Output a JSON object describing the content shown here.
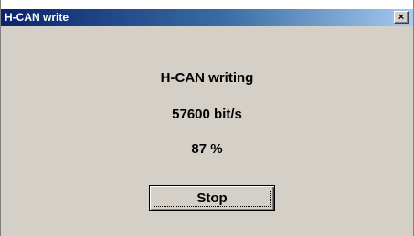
{
  "window": {
    "title": "H-CAN write",
    "close_glyph": "×",
    "titlebar_color_start": "#0a246a",
    "titlebar_color_end": "#a6caf0",
    "background_color": "#d4d0c8"
  },
  "status": {
    "heading": "H-CAN writing",
    "bitrate": "57600 bit/s",
    "progress": "87 %",
    "progress_value": 87
  },
  "actions": {
    "stop_label": "Stop"
  }
}
